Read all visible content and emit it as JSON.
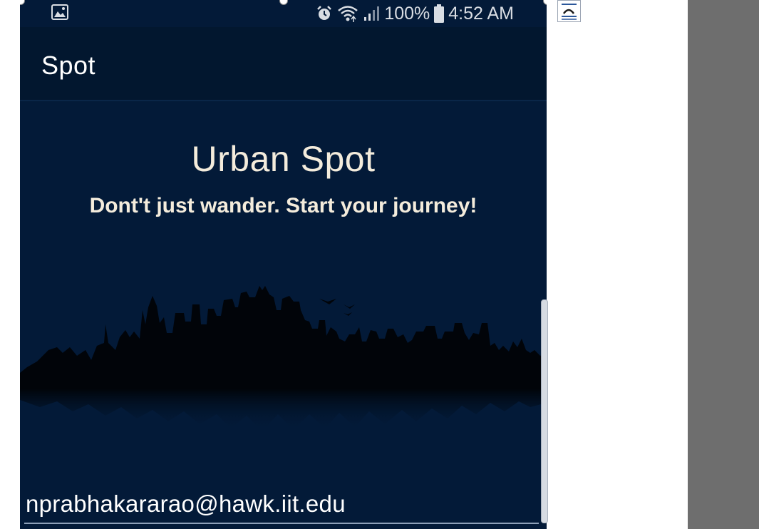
{
  "status_bar": {
    "battery": "100%",
    "time": "4:52 AM",
    "icons": [
      "gallery-icon",
      "alarm-icon",
      "wifi-icon",
      "signal-icon",
      "battery-icon"
    ]
  },
  "app_bar": {
    "title": "Spot"
  },
  "hero": {
    "title": "Urban Spot",
    "subtitle": "Dont't just wander. Start your journey!"
  },
  "account": {
    "email": "nprabhakararao@hawk.iit.edu"
  },
  "colors": {
    "background": "#031a38",
    "app_bar": "#02172f",
    "hero_text": "#f4ecdc",
    "right_panel": "#6e6e6e"
  }
}
